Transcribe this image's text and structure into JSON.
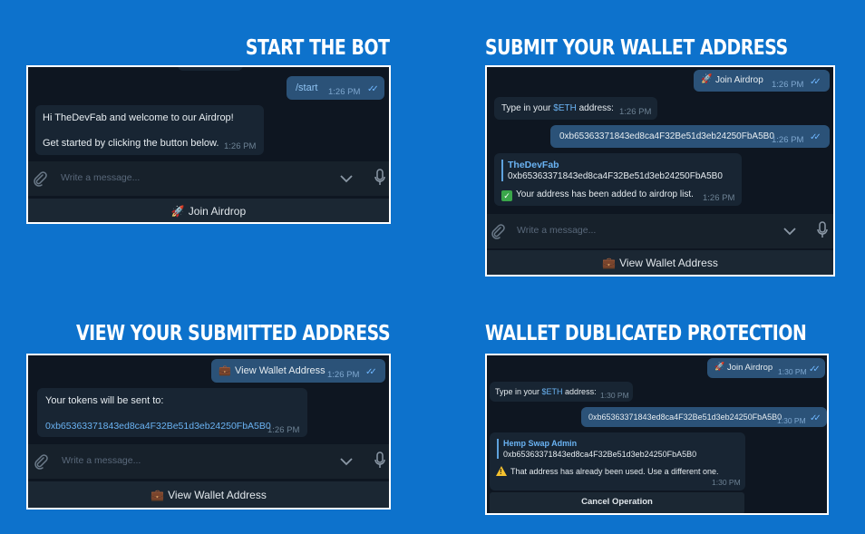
{
  "headings": {
    "start": "START THE BOT",
    "submit": "SUBMIT YOUR WALLET ADDRESS",
    "view": "VIEW YOUR SUBMITTED ADDRESS",
    "protect": "WALLET DUBLICATED PROTECTION"
  },
  "composer_placeholder": "Write a message...",
  "icons": [
    "paperclip-icon",
    "chevron-down-icon",
    "microphone-icon",
    "rocket-icon",
    "briefcase-icon",
    "double-check-icon",
    "check-mark-icon",
    "warning-icon"
  ],
  "colors": {
    "background": "#0d72cc",
    "chat_bg": "#0e1621",
    "incoming": "#182533",
    "outgoing": "#2b5278",
    "link": "#6ab3f3"
  },
  "panel1": {
    "out_msg": "/start",
    "out_time": "1:26 PM",
    "greet_line1": "Hi TheDevFab and welcome to our Airdrop!",
    "greet_line2": "Get started by clicking the button below.",
    "greet_time": "1:26 PM",
    "button": "Join Airdrop"
  },
  "panel2": {
    "join_msg": "Join Airdrop",
    "join_time": "1:26 PM",
    "type_prefix": "Type in your ",
    "type_token": "$ETH",
    "type_suffix": " address:",
    "type_time": "1:26 PM",
    "address_msg": "0xb65363371843ed8ca4F32Be51d3eb24250FbA5B0",
    "address_time": "1:26 PM",
    "quote_name": "TheDevFab",
    "quote_text": "0xb65363371843ed8ca4F32Be51d3eb24250FbA5B0",
    "confirm_text": "Your address has been added to airdrop list.",
    "confirm_time": "1:26 PM",
    "button": "View Wallet Address"
  },
  "panel3": {
    "out_msg": "View Wallet Address",
    "out_time": "1:26 PM",
    "line1": "Your tokens will be sent to:",
    "address": "0xb65363371843ed8ca4F32Be51d3eb24250FbA5B0",
    "time": "1:26 PM",
    "button": "View Wallet Address"
  },
  "panel4": {
    "join_msg": "Join Airdrop",
    "join_time": "1:30 PM",
    "type_prefix": "Type in your ",
    "type_token": "$ETH",
    "type_suffix": " address:",
    "type_time": "1:30 PM",
    "address_msg": "0xb65363371843ed8ca4F32Be51d3eb24250FbA5B0",
    "address_time": "1:30 PM",
    "quote_name": "Hemp Swap Admin",
    "quote_text": "0xb65363371843ed8ca4F32Be51d3eb24250FbA5B0",
    "warn_text": "That address has already been used. Use a different one.",
    "warn_time": "1:30 PM",
    "button": "Cancel Operation"
  }
}
